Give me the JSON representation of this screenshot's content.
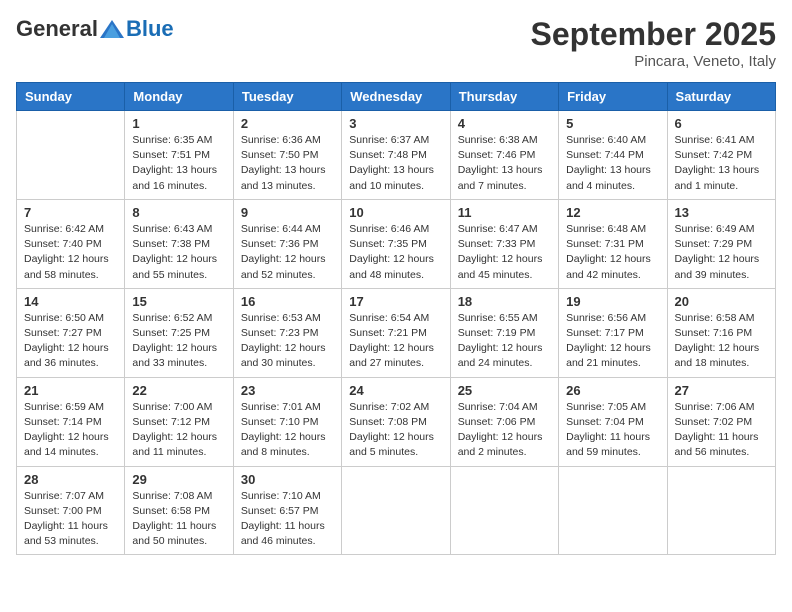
{
  "header": {
    "logo": {
      "general": "General",
      "blue": "Blue"
    },
    "title": "September 2025",
    "location": "Pincara, Veneto, Italy"
  },
  "days_of_week": [
    "Sunday",
    "Monday",
    "Tuesday",
    "Wednesday",
    "Thursday",
    "Friday",
    "Saturday"
  ],
  "weeks": [
    [
      {
        "day": "",
        "info": ""
      },
      {
        "day": "1",
        "info": "Sunrise: 6:35 AM\nSunset: 7:51 PM\nDaylight: 13 hours\nand 16 minutes."
      },
      {
        "day": "2",
        "info": "Sunrise: 6:36 AM\nSunset: 7:50 PM\nDaylight: 13 hours\nand 13 minutes."
      },
      {
        "day": "3",
        "info": "Sunrise: 6:37 AM\nSunset: 7:48 PM\nDaylight: 13 hours\nand 10 minutes."
      },
      {
        "day": "4",
        "info": "Sunrise: 6:38 AM\nSunset: 7:46 PM\nDaylight: 13 hours\nand 7 minutes."
      },
      {
        "day": "5",
        "info": "Sunrise: 6:40 AM\nSunset: 7:44 PM\nDaylight: 13 hours\nand 4 minutes."
      },
      {
        "day": "6",
        "info": "Sunrise: 6:41 AM\nSunset: 7:42 PM\nDaylight: 13 hours\nand 1 minute."
      }
    ],
    [
      {
        "day": "7",
        "info": "Sunrise: 6:42 AM\nSunset: 7:40 PM\nDaylight: 12 hours\nand 58 minutes."
      },
      {
        "day": "8",
        "info": "Sunrise: 6:43 AM\nSunset: 7:38 PM\nDaylight: 12 hours\nand 55 minutes."
      },
      {
        "day": "9",
        "info": "Sunrise: 6:44 AM\nSunset: 7:36 PM\nDaylight: 12 hours\nand 52 minutes."
      },
      {
        "day": "10",
        "info": "Sunrise: 6:46 AM\nSunset: 7:35 PM\nDaylight: 12 hours\nand 48 minutes."
      },
      {
        "day": "11",
        "info": "Sunrise: 6:47 AM\nSunset: 7:33 PM\nDaylight: 12 hours\nand 45 minutes."
      },
      {
        "day": "12",
        "info": "Sunrise: 6:48 AM\nSunset: 7:31 PM\nDaylight: 12 hours\nand 42 minutes."
      },
      {
        "day": "13",
        "info": "Sunrise: 6:49 AM\nSunset: 7:29 PM\nDaylight: 12 hours\nand 39 minutes."
      }
    ],
    [
      {
        "day": "14",
        "info": "Sunrise: 6:50 AM\nSunset: 7:27 PM\nDaylight: 12 hours\nand 36 minutes."
      },
      {
        "day": "15",
        "info": "Sunrise: 6:52 AM\nSunset: 7:25 PM\nDaylight: 12 hours\nand 33 minutes."
      },
      {
        "day": "16",
        "info": "Sunrise: 6:53 AM\nSunset: 7:23 PM\nDaylight: 12 hours\nand 30 minutes."
      },
      {
        "day": "17",
        "info": "Sunrise: 6:54 AM\nSunset: 7:21 PM\nDaylight: 12 hours\nand 27 minutes."
      },
      {
        "day": "18",
        "info": "Sunrise: 6:55 AM\nSunset: 7:19 PM\nDaylight: 12 hours\nand 24 minutes."
      },
      {
        "day": "19",
        "info": "Sunrise: 6:56 AM\nSunset: 7:17 PM\nDaylight: 12 hours\nand 21 minutes."
      },
      {
        "day": "20",
        "info": "Sunrise: 6:58 AM\nSunset: 7:16 PM\nDaylight: 12 hours\nand 18 minutes."
      }
    ],
    [
      {
        "day": "21",
        "info": "Sunrise: 6:59 AM\nSunset: 7:14 PM\nDaylight: 12 hours\nand 14 minutes."
      },
      {
        "day": "22",
        "info": "Sunrise: 7:00 AM\nSunset: 7:12 PM\nDaylight: 12 hours\nand 11 minutes."
      },
      {
        "day": "23",
        "info": "Sunrise: 7:01 AM\nSunset: 7:10 PM\nDaylight: 12 hours\nand 8 minutes."
      },
      {
        "day": "24",
        "info": "Sunrise: 7:02 AM\nSunset: 7:08 PM\nDaylight: 12 hours\nand 5 minutes."
      },
      {
        "day": "25",
        "info": "Sunrise: 7:04 AM\nSunset: 7:06 PM\nDaylight: 12 hours\nand 2 minutes."
      },
      {
        "day": "26",
        "info": "Sunrise: 7:05 AM\nSunset: 7:04 PM\nDaylight: 11 hours\nand 59 minutes."
      },
      {
        "day": "27",
        "info": "Sunrise: 7:06 AM\nSunset: 7:02 PM\nDaylight: 11 hours\nand 56 minutes."
      }
    ],
    [
      {
        "day": "28",
        "info": "Sunrise: 7:07 AM\nSunset: 7:00 PM\nDaylight: 11 hours\nand 53 minutes."
      },
      {
        "day": "29",
        "info": "Sunrise: 7:08 AM\nSunset: 6:58 PM\nDaylight: 11 hours\nand 50 minutes."
      },
      {
        "day": "30",
        "info": "Sunrise: 7:10 AM\nSunset: 6:57 PM\nDaylight: 11 hours\nand 46 minutes."
      },
      {
        "day": "",
        "info": ""
      },
      {
        "day": "",
        "info": ""
      },
      {
        "day": "",
        "info": ""
      },
      {
        "day": "",
        "info": ""
      }
    ]
  ]
}
